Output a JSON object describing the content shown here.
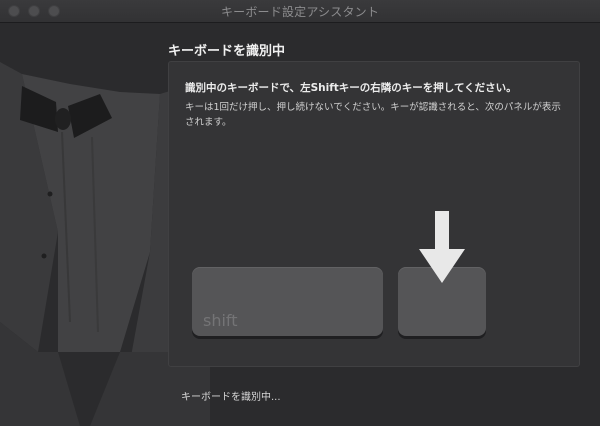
{
  "window": {
    "title": "キーボード設定アシスタント"
  },
  "heading": "キーボードを識別中",
  "instructions": {
    "main": "識別中のキーボードで、左Shiftキーの右隣のキーを押してください。",
    "sub": "キーは1回だけ押し、押し続けないでください。キーが認識されると、次のパネルが表示されます。"
  },
  "keys": {
    "shift_label": "shift",
    "target_label": ""
  },
  "status": "キーボードを識別中...",
  "icons": {
    "close": "close-dot-icon",
    "minimize": "minimize-dot-icon",
    "zoom": "zoom-dot-icon",
    "arrow": "arrow-down-icon",
    "illustration": "tuxedo-illustration"
  },
  "colors": {
    "background": "#2b2b2d",
    "panel": "#343436",
    "key": "#555557",
    "arrow": "#e8e8e8"
  }
}
